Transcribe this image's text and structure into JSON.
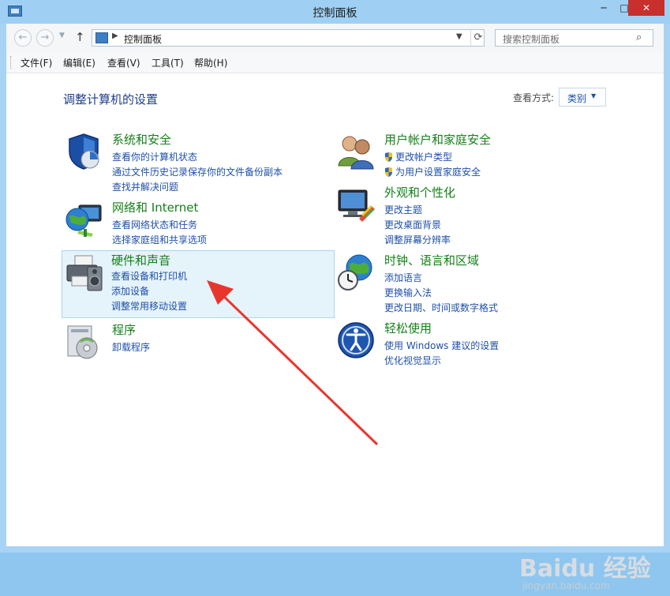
{
  "window": {
    "title": "控制面板"
  },
  "titlebar": {
    "minimize": "─",
    "maximize": "□",
    "close": "✕"
  },
  "address": {
    "path": "控制面板",
    "refresh_icon": "refresh-icon",
    "search_placeholder": "搜索控制面板"
  },
  "menubar": {
    "items": [
      "文件(F)",
      "编辑(E)",
      "查看(V)",
      "工具(T)",
      "帮助(H)"
    ]
  },
  "main": {
    "heading": "调整计算机的设置",
    "view_label": "查看方式:",
    "view_value": "类别"
  },
  "categories": [
    {
      "title": "系统和安全",
      "links": [
        "查看你的计算机状态",
        "通过文件历史记录保存你的文件备份副本",
        "查找并解决问题"
      ],
      "icon": "shield-icon"
    },
    {
      "title": "网络和 Internet",
      "links": [
        "查看网络状态和任务",
        "选择家庭组和共享选项"
      ],
      "icon": "globe-network-icon"
    },
    {
      "title": "硬件和声音",
      "links": [
        "查看设备和打印机",
        "添加设备",
        "调整常用移动设置"
      ],
      "icon": "printer-speaker-icon"
    },
    {
      "title": "程序",
      "links": [
        "卸载程序"
      ],
      "icon": "programs-icon"
    },
    {
      "title": "用户帐户和家庭安全",
      "links": [
        "更改帐户类型",
        "为用户设置家庭安全"
      ],
      "icon": "users-icon"
    },
    {
      "title": "外观和个性化",
      "links": [
        "更改主题",
        "更改桌面背景",
        "调整屏幕分辨率"
      ],
      "icon": "monitor-icon"
    },
    {
      "title": "时钟、语言和区域",
      "links": [
        "添加语言",
        "更换输入法",
        "更改日期、时间或数字格式"
      ],
      "icon": "clock-globe-icon"
    },
    {
      "title": "轻松使用",
      "links": [
        "使用 Windows 建议的设置",
        "优化视觉显示"
      ],
      "icon": "ease-of-access-icon"
    }
  ],
  "annotation": {
    "arrow_color": "#e8362f"
  },
  "watermark": {
    "brand": "Baidu 经验",
    "url": "jingyan.baidu.com"
  }
}
